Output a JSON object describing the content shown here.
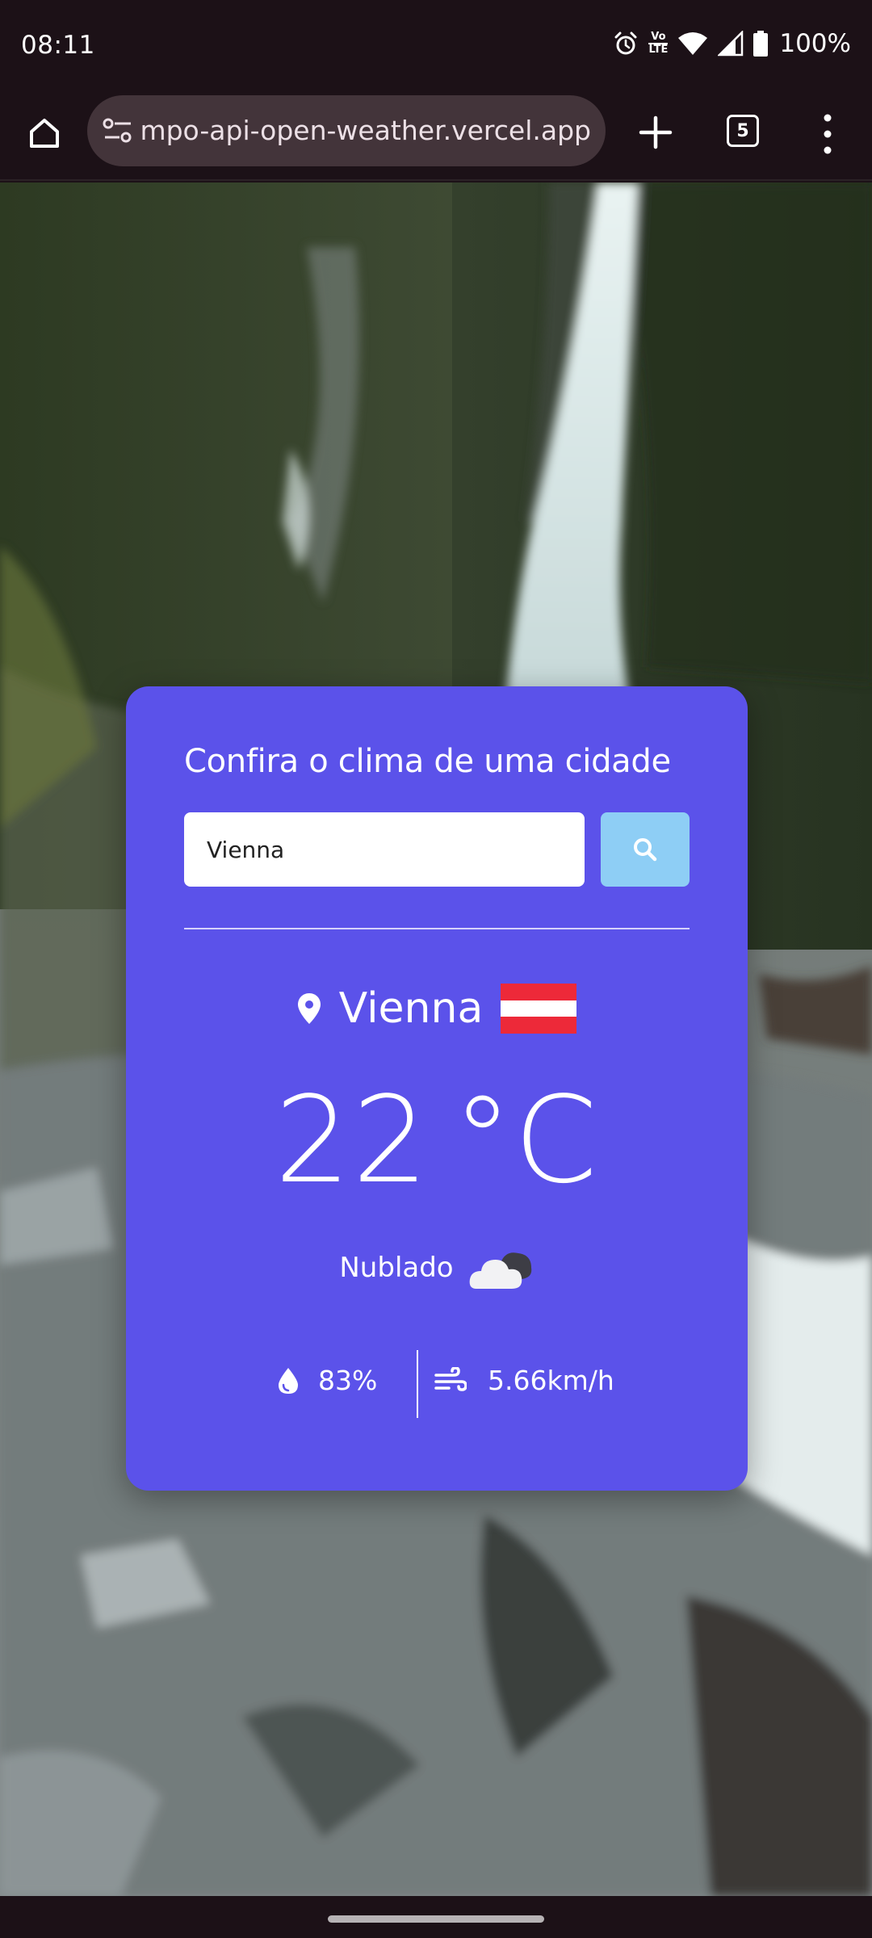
{
  "status_bar": {
    "time": "08:11",
    "battery": "100%",
    "network": "LTE",
    "volte_line1": "Vo",
    "volte_line2": "LTE",
    "icons": [
      "alarm-icon",
      "volte-icon",
      "wifi-icon",
      "signal-icon",
      "battery-icon"
    ]
  },
  "browser": {
    "url": "mpo-api-open-weather.vercel.app",
    "tab_count": "5",
    "icons": [
      "home-icon",
      "site-info-icon",
      "plus-icon",
      "tabs-icon",
      "more-vert-icon"
    ]
  },
  "weather": {
    "title": "Confira o clima de uma cidade",
    "search_value": "Vienna",
    "city": "Vienna",
    "country_flag": "austria-flag",
    "flag_colors": [
      "#ed2939",
      "#ffffff",
      "#ed2939"
    ],
    "temperature": "22",
    "unit": "°C",
    "description": "Nublado",
    "humidity": "83%",
    "wind": "5.66km/h",
    "card_color": "#5b52ea",
    "search_button_color": "#8ecef5"
  }
}
